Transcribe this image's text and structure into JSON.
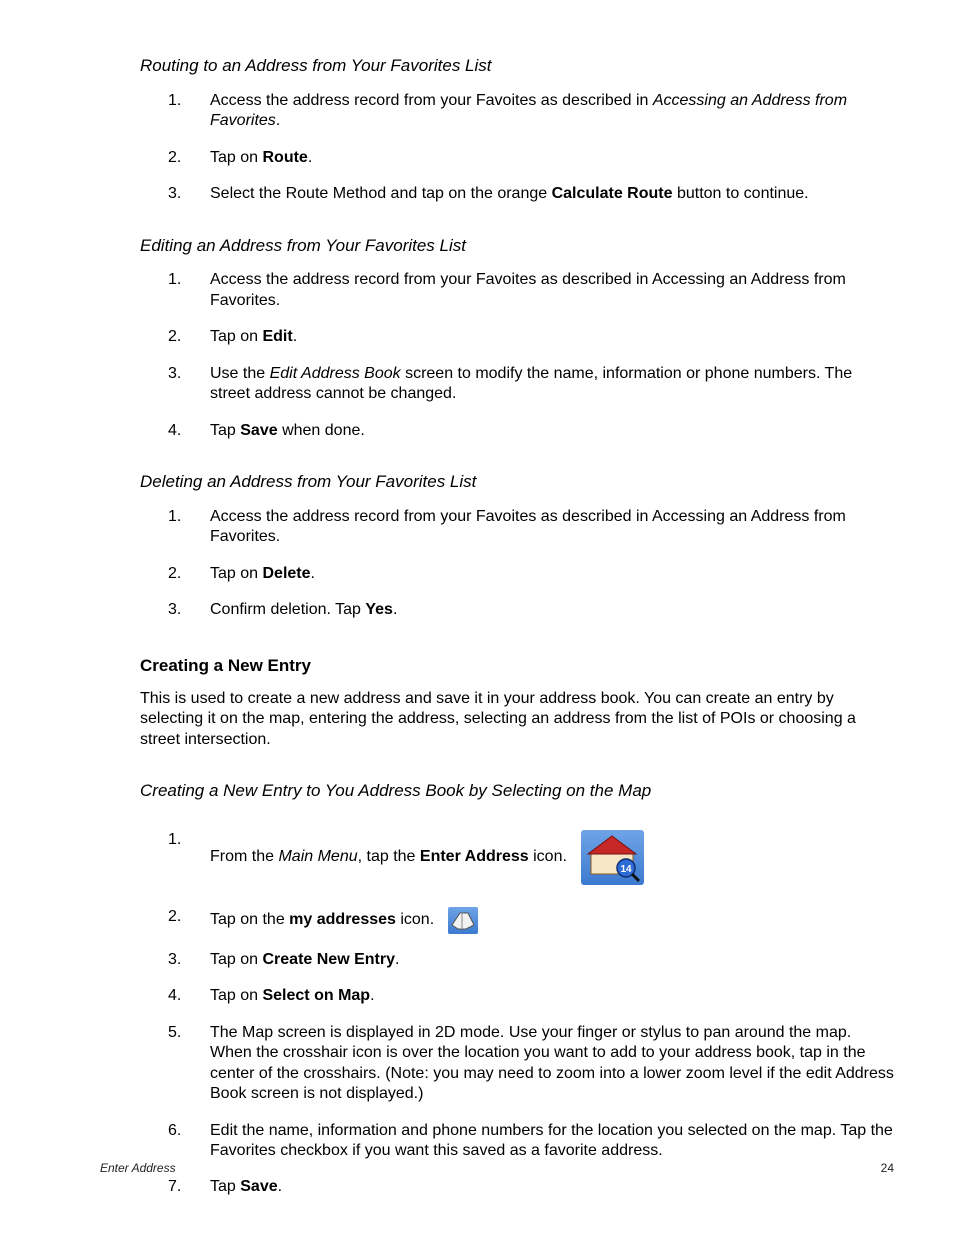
{
  "sections": {
    "routing": {
      "heading": "Routing to an Address from Your Favorites List",
      "item1_pre": "Access the address record from your Favoites as described in ",
      "item1_em": "Accessing an Address from Favorites",
      "item1_post": ".",
      "item2_pre": "Tap on ",
      "item2_b": "Route",
      "item2_post": ".",
      "item3_pre": "Select the Route Method and tap on the orange ",
      "item3_b": "Calculate Route",
      "item3_post": " button to continue."
    },
    "editing": {
      "heading": "Editing an Address from Your Favorites List",
      "item1": "Access the address record from your Favoites as described in Accessing an Address from Favorites.",
      "item2_pre": "Tap on ",
      "item2_b": "Edit",
      "item2_post": ".",
      "item3_pre": "Use the ",
      "item3_em": "Edit Address Book",
      "item3_post": " screen to modify the name, information or phone numbers.  The street address cannot be changed.",
      "item4_pre": "Tap ",
      "item4_b": "Save",
      "item4_post": " when done."
    },
    "deleting": {
      "heading": "Deleting an Address from Your Favorites List",
      "item1": "Access the address record from your Favoites as described in Accessing an Address from Favorites.",
      "item2_pre": "Tap on ",
      "item2_b": "Delete",
      "item2_post": ".",
      "item3_pre": "Confirm deletion.  Tap ",
      "item3_b": "Yes",
      "item3_post": "."
    },
    "creating": {
      "heading": "Creating a New Entry",
      "para": "This is used to create a new address and save it in your address book.  You can create an entry by selecting it on the map, entering the address, selecting an address from the list of POIs or choosing a street intersection."
    },
    "creating_map": {
      "heading": "Creating a New Entry to You Address Book by Selecting on the Map",
      "item1_pre": "From the ",
      "item1_em": "Main Menu",
      "item1_mid": ", tap the ",
      "item1_b": "Enter Address",
      "item1_post": " icon.",
      "item2_pre": "Tap on the ",
      "item2_b": "my addresses",
      "item2_post": " icon.",
      "item3_pre": "Tap on ",
      "item3_b": "Create New Entry",
      "item3_post": ".",
      "item4_pre": "Tap on ",
      "item4_b": "Select on Map",
      "item4_post": ".",
      "item5": "The Map screen is displayed in 2D mode.  Use your finger or stylus to pan around the map.  When the crosshair icon is over the location you want to add to your address book, tap in the center of the crosshairs.  (Note: you may need to zoom into a lower zoom level if the edit Address Book screen is not displayed.)",
      "item6": "Edit the name, information and phone numbers for the location you selected on the map.  Tap the Favorites checkbox if you want this saved as a favorite address.",
      "item7_pre": "Tap ",
      "item7_b": "Save",
      "item7_post": "."
    }
  },
  "nums": {
    "n1": "1.",
    "n2": "2.",
    "n3": "3.",
    "n4": "4.",
    "n5": "5.",
    "n6": "6.",
    "n7": "7."
  },
  "footer": {
    "section": "Enter Address",
    "page": "24"
  }
}
